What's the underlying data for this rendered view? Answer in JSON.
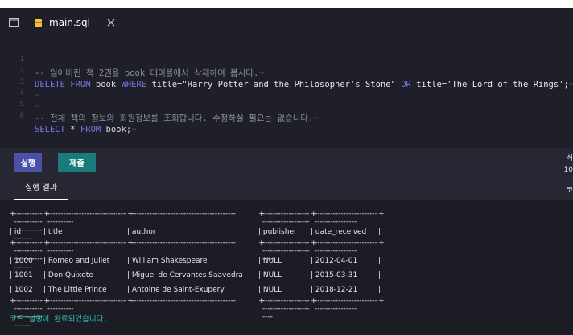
{
  "tab": {
    "label": "main.sql"
  },
  "editor": {
    "line_numbers": [
      "1",
      "2",
      "3",
      "4",
      "5",
      "6"
    ],
    "line1": "-- 잃어버린 책 2권을 book 테이블에서 삭제하여 봅시다.",
    "line2": {
      "kw1": "DELETE FROM",
      "ident": "book",
      "kw2": "WHERE",
      "cond1": "title=\"Harry Potter and the Philosopher's Stone\"",
      "kw3": "OR",
      "cond2": "title='The Lord of the Rings';"
    },
    "line5": "-- 전체 책의 정보와 회원정보를 조회합니다. 수정하실 필요는 없습니다.",
    "line6": {
      "kw1": "SELECT",
      "star": "*",
      "kw2": "FROM",
      "ident": "book;"
    },
    "eol_marker": "¬"
  },
  "toolbar": {
    "run_label": "실행",
    "submit_label": "제출"
  },
  "side_text": {
    "a": "최",
    "b": "10",
    "c": "코"
  },
  "results_tab": {
    "label": "실행 결과"
  },
  "result_table": {
    "columns": [
      "id",
      "title",
      "author",
      "publisher",
      "date_received"
    ],
    "rows": [
      [
        "1000",
        "Romeo and Juliet",
        "William Shakespeare",
        "NULL",
        "2012-04-01"
      ],
      [
        "1001",
        "Don Quixote",
        "Miguel de Cervantes Saavedra",
        "NULL",
        "2015-03-31"
      ],
      [
        "1002",
        "The Little Prince",
        "Antoine de Saint-Exupery",
        "NULL",
        "2018-12-21"
      ]
    ]
  },
  "status": "코드 실행이 완료되었습니다.",
  "colors": {
    "keyword": "#7b74e6",
    "status": "#2fc4b2",
    "run_button": "#4b50a8",
    "submit_button": "#1b7a7c"
  }
}
